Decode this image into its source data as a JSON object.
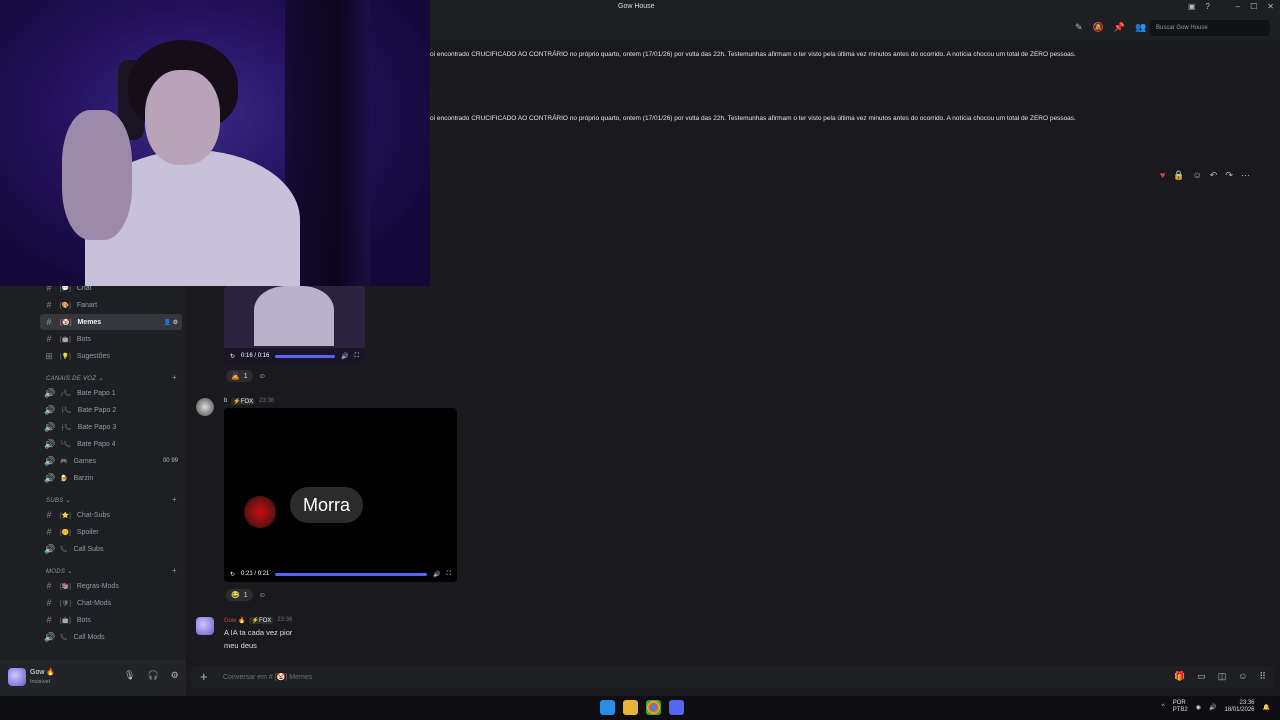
{
  "window": {
    "title": "Gow House"
  },
  "topbar": {
    "search_placeholder": "Buscar Gow House"
  },
  "banner": {
    "line1": "oi encontrado CRUCIFICADO AO CONTRÁRIO no próprio quarto, ontem (17/01/26) por volta das 22h. Testemunhas afirmam o ter visto pela última vez minutos antes do ocorrido. A notícia chocou um total de ZERO pessoas.",
    "line2": "oi encontrado CRUCIFICADO AO CONTRÁRIO no próprio quarto, ontem (17/01/26) por volta das 22h. Testemunhas afirmam o ter visto pela última vez minutos antes do ocorrido. A notícia chocou um total de ZERO pessoas."
  },
  "sidebar": {
    "channels": [
      {
        "name": "Chat",
        "prefix": "[💬]"
      },
      {
        "name": "Fanart",
        "prefix": "[🎨]"
      },
      {
        "name": "Memes",
        "prefix": "[🤡]",
        "active": true
      },
      {
        "name": "Bots",
        "prefix": "[🤖]"
      },
      {
        "name": "Sugestões",
        "prefix": "[💡]"
      }
    ],
    "cat_voz": "CANAIS DE VOZ",
    "voice": [
      {
        "name": "Bate Papo 1",
        "prefix": "╭📞"
      },
      {
        "name": "Bate Papo 2",
        "prefix": "├📞"
      },
      {
        "name": "Bate Papo 3",
        "prefix": "├📞"
      },
      {
        "name": "Bate Papo 4",
        "prefix": "╰📞"
      },
      {
        "name": "Games",
        "prefix": "🎮",
        "badge1": "00",
        "badge2": "99"
      },
      {
        "name": "Barzin",
        "prefix": "🍺"
      }
    ],
    "cat_subs": "SUBS",
    "subs": [
      {
        "name": "Chat-Subs",
        "prefix": "[⭐]"
      },
      {
        "name": "Spoiler",
        "prefix": "[🤫]"
      },
      {
        "name": "Call Subs",
        "prefix": "📞"
      }
    ],
    "cat_mods": "MODS",
    "mods": [
      {
        "name": "Regras-Mods",
        "prefix": "[📚]"
      },
      {
        "name": "Chat-Mods",
        "prefix": "[🛡]"
      },
      {
        "name": "Bots",
        "prefix": "[🤖]"
      },
      {
        "name": "Call Mods",
        "prefix": "📞"
      }
    ]
  },
  "user": {
    "name": "Gow 🔥",
    "status": "Invisível"
  },
  "messages": {
    "video1": {
      "time": "0:16 / 0:16",
      "reaction_count": "1"
    },
    "msg2": {
      "author": "b",
      "tag": "⚡FOX",
      "time": "23:36",
      "video_caption": "Morra",
      "video_time": "0:21 / 0:21",
      "reaction_count": "1"
    },
    "msg3": {
      "author": "Gow 🔥",
      "tag": "⚡FOX",
      "time": "23:36",
      "line1": "A IA ta cada vez pior",
      "line2": "meu deus"
    }
  },
  "input": {
    "placeholder": "Conversar em #",
    "channel": "[🤡] Memes"
  },
  "taskbar": {
    "lang1": "POR",
    "lang2": "PTB2",
    "time": "23:36",
    "date": "18/01/2026"
  },
  "colors": {
    "accent": "#5865f2",
    "bg": "#1a1a1e",
    "sidebar": "#1e1f22"
  }
}
